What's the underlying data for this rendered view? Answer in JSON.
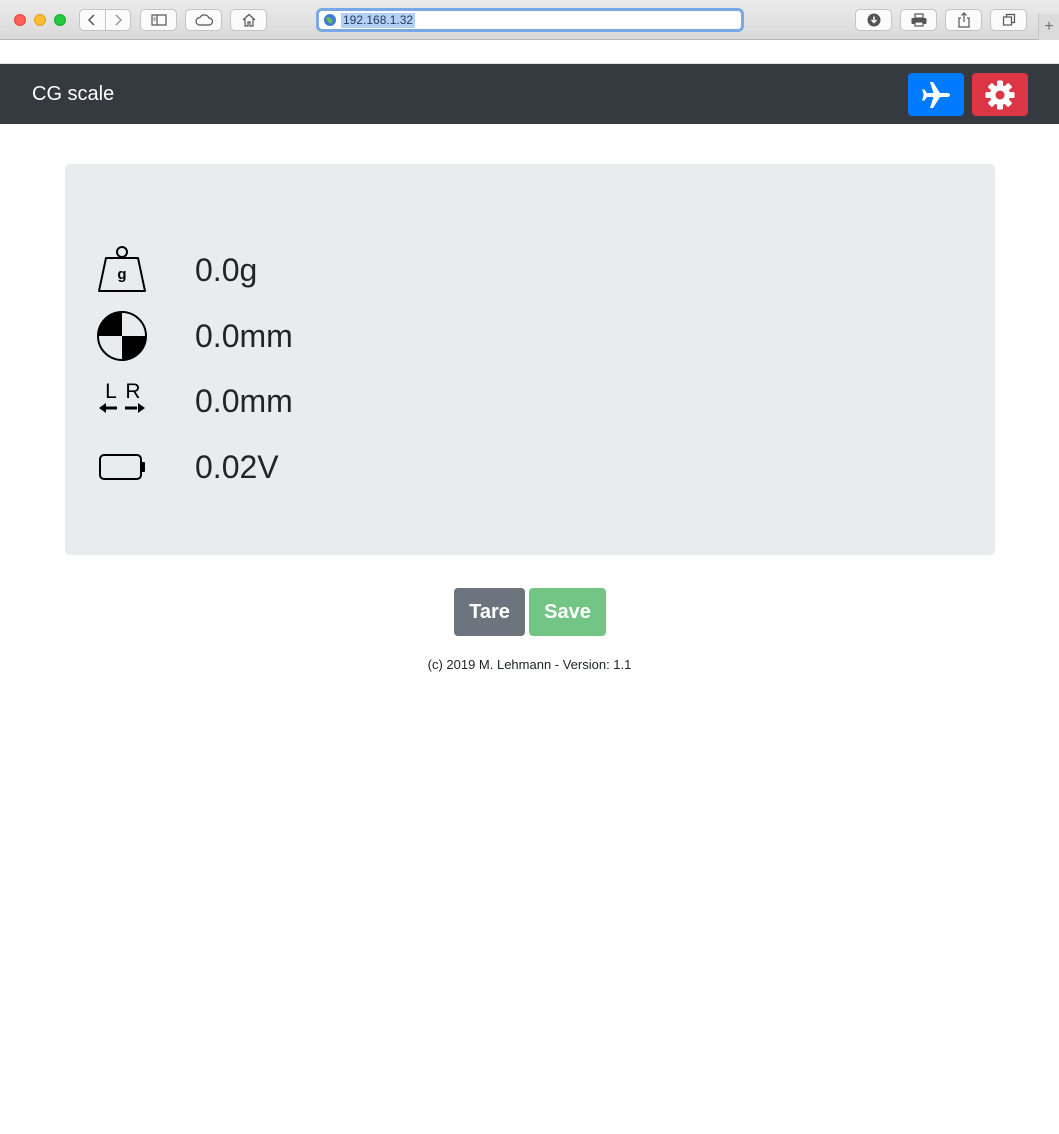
{
  "browser": {
    "url": "192.168.1.32",
    "new_tab_label": "+"
  },
  "navbar": {
    "brand": "CG scale",
    "plane_button_icon": "airplane-icon",
    "settings_button_icon": "gear-icon",
    "colors": {
      "navbar": "#343a40",
      "plane_button": "#007bff",
      "settings_button": "#dc3545"
    }
  },
  "readings": {
    "weight": {
      "icon": "weight-icon",
      "icon_letter": "g",
      "value": "0.0g"
    },
    "cg": {
      "icon": "cg-icon",
      "value": "0.0mm"
    },
    "lateral": {
      "icon": "lateral-icon",
      "icon_left": "L",
      "icon_right": "R",
      "value": "0.0mm"
    },
    "battery": {
      "icon": "battery-icon",
      "value": "0.02V"
    }
  },
  "actions": {
    "tare_label": "Tare",
    "save_label": "Save",
    "colors": {
      "tare": "#6c757d",
      "save": "#28a745"
    }
  },
  "footer": {
    "text": "(c) 2019 M. Lehmann - Version: 1.1"
  }
}
